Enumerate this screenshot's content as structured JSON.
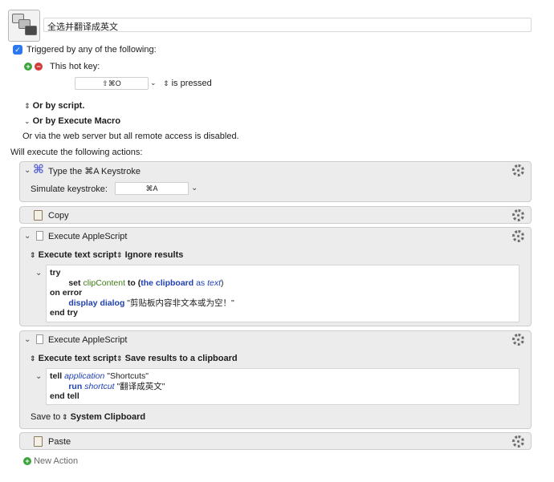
{
  "macro": {
    "name": "全选并翻译成英文"
  },
  "triggers": {
    "checkbox_label": "Triggered by any of the following:",
    "hotkey_title": "This hot key:",
    "hotkey_value": "⇧⌘O",
    "hotkey_mode": "is pressed",
    "or_by_script": "Or by script.",
    "or_by_execute_macro": "Or by Execute Macro",
    "web_server_note": "Or via the web server but all remote access is disabled."
  },
  "actions_heading": "Will execute the following actions:",
  "actions": [
    {
      "title": "Type the ⌘A Keystroke",
      "simulate_label": "Simulate keystroke:",
      "keystroke": "⌘A"
    },
    {
      "title": "Copy"
    },
    {
      "title": "Execute AppleScript",
      "option1": "Execute text script",
      "option2": "Ignore results",
      "code": {
        "l1": "try",
        "l2_set": "set",
        "l2_var": "clipContent",
        "l2_to": "to (",
        "l2_the": "the clipboard",
        "l2_as": "as",
        "l2_text": "text",
        "l2_close": ")",
        "l3": "on error",
        "l4_cmd": "display dialog",
        "l4_str": "\"剪贴板内容非文本或为空！\"",
        "l5": "end try"
      }
    },
    {
      "title": "Execute AppleScript",
      "option1": "Execute text script",
      "option2": "Save results to a clipboard",
      "code": {
        "l1_tell": "tell",
        "l1_app": "application",
        "l1_str": "\"Shortcuts\"",
        "l2_run": "run",
        "l2_short": "shortcut",
        "l2_str": "\"翻译成英文\"",
        "l3": "end tell"
      },
      "save_to_label": "Save to",
      "save_to_value": "System Clipboard"
    },
    {
      "title": "Paste"
    }
  ],
  "new_action_label": "New Action"
}
